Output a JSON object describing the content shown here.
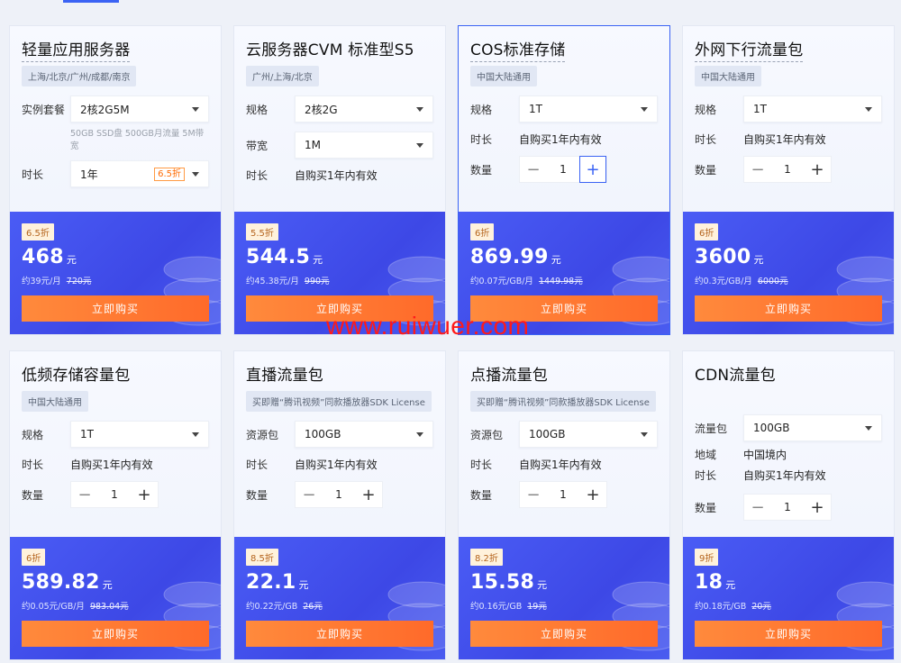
{
  "cards": [
    {
      "title": "轻量应用服务器",
      "tag": "上海/北京/广州/成都/南京",
      "rows": [
        {
          "label": "实例套餐",
          "type": "select",
          "value": "2核2G5M"
        },
        {
          "type": "note",
          "value": "50GB SSD盘 500GB月流量 5M带宽"
        },
        {
          "label": "时长",
          "type": "select",
          "value": "1年",
          "badge": "6.5折"
        }
      ],
      "discount": "6.5折",
      "price": "468",
      "unit": "元",
      "sub": "约39元/月",
      "orig": "720元",
      "buy": "立即购买"
    },
    {
      "title": "云服务器CVM 标准型S5",
      "tag": "广州/上海/北京",
      "rows": [
        {
          "label": "规格",
          "type": "select",
          "value": "2核2G"
        },
        {
          "label": "带宽",
          "type": "select",
          "value": "1M"
        },
        {
          "label": "时长",
          "type": "text",
          "value": "自购买1年内有效"
        }
      ],
      "discount": "5.5折",
      "price": "544.5",
      "unit": "元",
      "sub": "约45.38元/月",
      "orig": "990元",
      "buy": "立即购买"
    },
    {
      "title": "COS标准存储",
      "tag": "中国大陆通用",
      "rows": [
        {
          "label": "规格",
          "type": "select",
          "value": "1T"
        },
        {
          "label": "时长",
          "type": "text",
          "value": "自购买1年内有效"
        },
        {
          "label": "数量",
          "type": "stepper",
          "value": "1",
          "highlight": true
        }
      ],
      "discount": "6折",
      "price": "869.99",
      "unit": "元",
      "sub": "约0.07元/GB/月",
      "orig": "1449.98元",
      "buy": "立即购买"
    },
    {
      "title": "外网下行流量包",
      "tag": "中国大陆通用",
      "rows": [
        {
          "label": "规格",
          "type": "select",
          "value": "1T"
        },
        {
          "label": "时长",
          "type": "text",
          "value": "自购买1年内有效"
        },
        {
          "label": "数量",
          "type": "stepper",
          "value": "1"
        }
      ],
      "discount": "6折",
      "price": "3600",
      "unit": "元",
      "sub": "约0.3元/GB/月",
      "orig": "6000元",
      "buy": "立即购买"
    },
    {
      "title": "低频存储容量包",
      "tag": "中国大陆通用",
      "rows": [
        {
          "label": "规格",
          "type": "select",
          "value": "1T"
        },
        {
          "label": "时长",
          "type": "text",
          "value": "自购买1年内有效"
        },
        {
          "label": "数量",
          "type": "stepper",
          "value": "1"
        }
      ],
      "discount": "6折",
      "price": "589.82",
      "unit": "元",
      "sub": "约0.05元/GB/月",
      "orig": "983.04元",
      "buy": "立即购买"
    },
    {
      "title": "直播流量包",
      "tag": "买即赠“腾讯视频”同款播放器SDK License",
      "rows": [
        {
          "label": "资源包",
          "type": "select",
          "value": "100GB"
        },
        {
          "label": "时长",
          "type": "text",
          "value": "自购买1年内有效"
        },
        {
          "label": "数量",
          "type": "stepper",
          "value": "1"
        }
      ],
      "discount": "8.5折",
      "price": "22.1",
      "unit": "元",
      "sub": "约0.22元/GB",
      "orig": "26元",
      "buy": "立即购买"
    },
    {
      "title": "点播流量包",
      "tag": "买即赠“腾讯视频”同款播放器SDK License",
      "rows": [
        {
          "label": "资源包",
          "type": "select",
          "value": "100GB"
        },
        {
          "label": "时长",
          "type": "text",
          "value": "自购买1年内有效"
        },
        {
          "label": "数量",
          "type": "stepper",
          "value": "1"
        }
      ],
      "discount": "8.2折",
      "price": "15.58",
      "unit": "元",
      "sub": "约0.16元/GB",
      "orig": "19元",
      "buy": "立即购买"
    },
    {
      "title": "CDN流量包",
      "tag": "",
      "rows": [
        {
          "label": "流量包",
          "type": "select",
          "value": "100GB"
        },
        {
          "label": "地域",
          "type": "text",
          "value": "中国境内"
        },
        {
          "label": "时长",
          "type": "text",
          "value": "自购买1年内有效"
        },
        {
          "label": "数量",
          "type": "stepper",
          "value": "1"
        }
      ],
      "discount": "9折",
      "price": "18",
      "unit": "元",
      "sub": "约0.18元/GB",
      "orig": "20元",
      "buy": "立即购买"
    }
  ],
  "watermark": "www.ruiwuer.com",
  "colors": {
    "accent": "#3b63f4",
    "price_bg": "#4452ee",
    "buy_btn": "#ff7a33",
    "discount_tag_bg": "#fff2dc"
  }
}
